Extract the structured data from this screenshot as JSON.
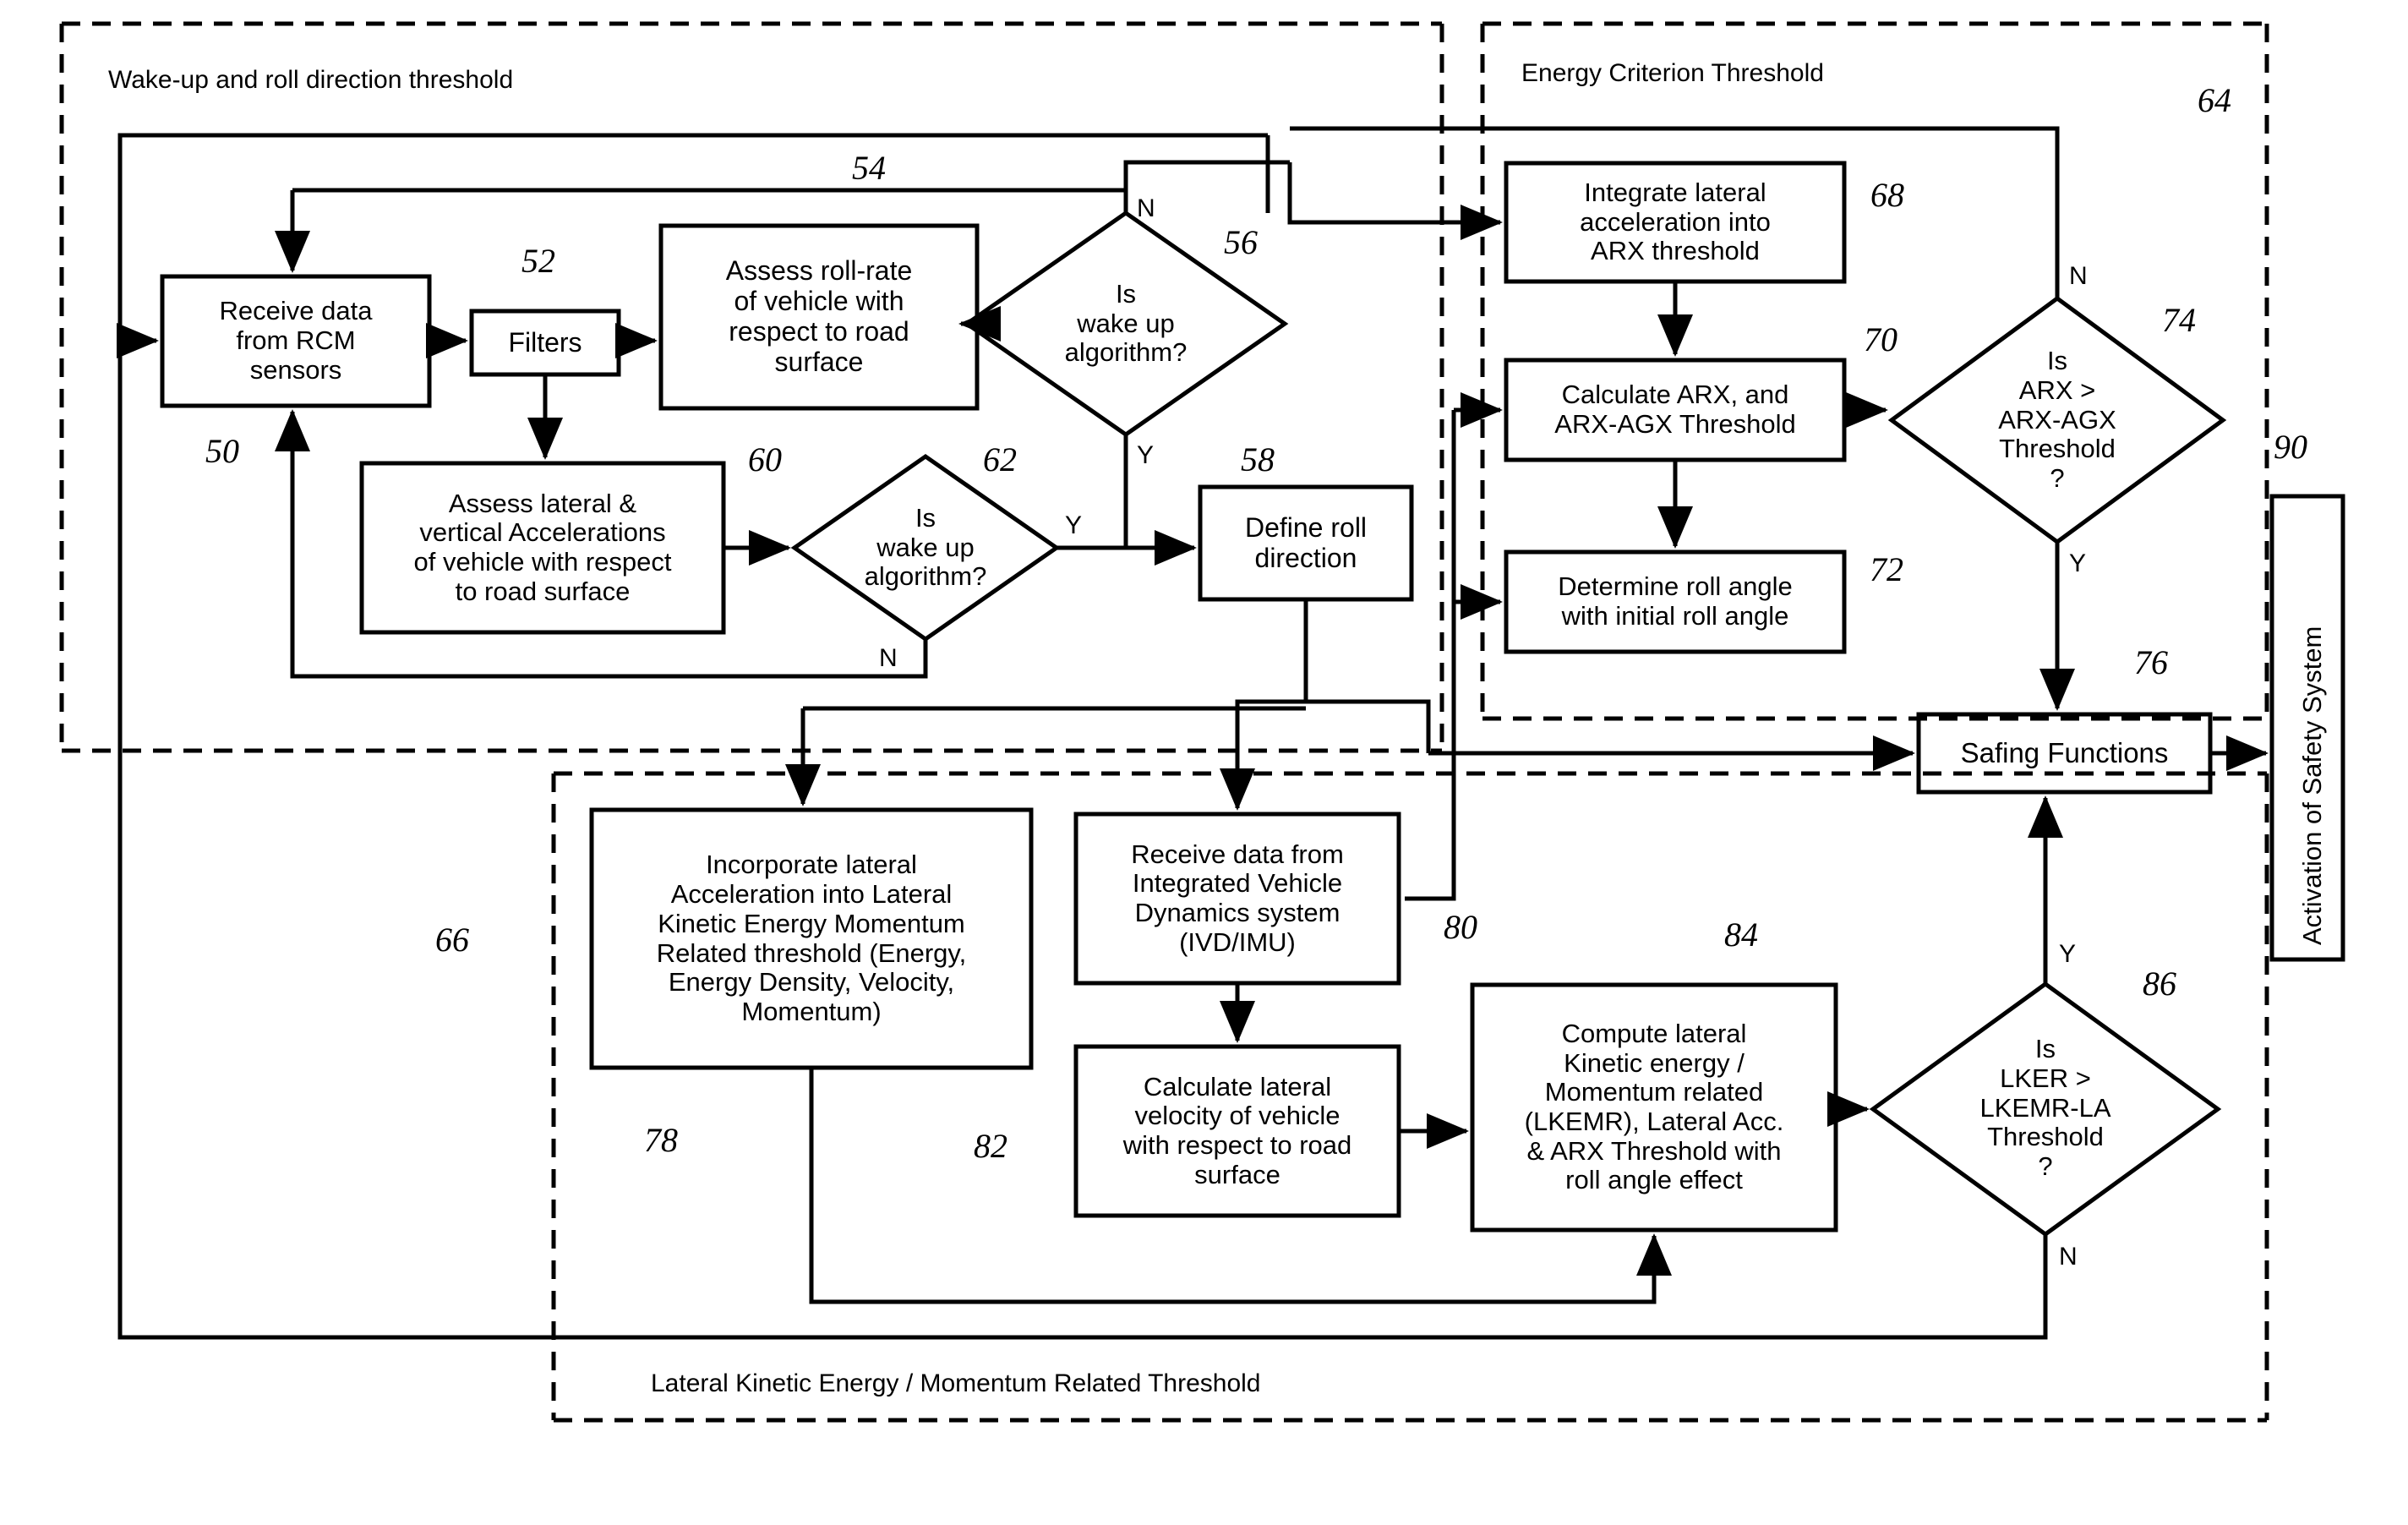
{
  "figure": {
    "title": "Vehicle rollover detection algorithm flowchart",
    "groups": [
      {
        "id": "wakeup",
        "label": "Wake-up and roll direction threshold",
        "ref": ""
      },
      {
        "id": "energy",
        "label": "Energy Criterion Threshold",
        "ref": "64"
      },
      {
        "id": "lkemr",
        "label": "Lateral Kinetic Energy / Momentum Related Threshold",
        "ref": "66"
      }
    ],
    "nodes": [
      {
        "id": "n50",
        "ref": "50",
        "shape": "process",
        "text": "Receive data\nfrom RCM\nsensors"
      },
      {
        "id": "n52",
        "ref": "52",
        "shape": "process",
        "text": "Filters"
      },
      {
        "id": "n54",
        "ref": "54",
        "shape": "process",
        "text": "Assess roll-rate\nof vehicle with\nrespect to road\nsurface"
      },
      {
        "id": "n56",
        "ref": "56",
        "shape": "decision",
        "text": "Is\nwake up\nalgorithm?"
      },
      {
        "id": "n58",
        "ref": "58",
        "shape": "process",
        "text": "Define roll\ndirection"
      },
      {
        "id": "n60",
        "ref": "60",
        "shape": "process",
        "text": "Assess lateral &\nvertical Accelerations\nof vehicle with respect\nto road surface"
      },
      {
        "id": "n62",
        "ref": "62",
        "shape": "decision",
        "text": "Is\nwake up\nalgorithm?"
      },
      {
        "id": "n68",
        "ref": "68",
        "shape": "process",
        "text": "Integrate lateral\nacceleration into\nARX threshold"
      },
      {
        "id": "n70",
        "ref": "70",
        "shape": "process",
        "text": "Calculate ARX, and\nARX-AGX Threshold"
      },
      {
        "id": "n72",
        "ref": "72",
        "shape": "process",
        "text": "Determine roll angle\nwith initial roll angle"
      },
      {
        "id": "n74",
        "ref": "74",
        "shape": "decision",
        "text": "Is\nARX >\nARX-AGX\nThreshold\n?"
      },
      {
        "id": "n76",
        "ref": "76",
        "shape": "process",
        "text": "Safing Functions"
      },
      {
        "id": "n78",
        "ref": "78",
        "shape": "process",
        "text": "Incorporate lateral\nAcceleration into Lateral\nKinetic Energy Momentum\nRelated threshold (Energy,\nEnergy Density, Velocity,\nMomentum)"
      },
      {
        "id": "n80",
        "ref": "80",
        "shape": "process",
        "text": "Receive data from\nIntegrated Vehicle\nDynamics system\n(IVD/IMU)"
      },
      {
        "id": "n82",
        "ref": "82",
        "shape": "process",
        "text": "Calculate lateral\nvelocity of vehicle\nwith respect to road\nsurface"
      },
      {
        "id": "n84",
        "ref": "84",
        "shape": "process",
        "text": "Compute lateral\nKinetic energy /\nMomentum related\n(LKEMR), Lateral Acc.\n& ARX Threshold with\nroll angle effect"
      },
      {
        "id": "n86",
        "ref": "86",
        "shape": "decision",
        "text": "Is\nLKER >\nLKEMR-LA\nThreshold\n?"
      },
      {
        "id": "n90",
        "ref": "90",
        "shape": "process",
        "text": "Activation of Safety System"
      }
    ],
    "branch_labels": [
      {
        "id": "b56n",
        "text": "N"
      },
      {
        "id": "b56y",
        "text": "Y"
      },
      {
        "id": "b62y",
        "text": "Y"
      },
      {
        "id": "b62n",
        "text": "N"
      },
      {
        "id": "b74n",
        "text": "N"
      },
      {
        "id": "b74y",
        "text": "Y"
      },
      {
        "id": "b86y",
        "text": "Y"
      },
      {
        "id": "b86n",
        "text": "N"
      }
    ],
    "colors": {
      "stroke": "#000000",
      "background": "#ffffff"
    }
  }
}
